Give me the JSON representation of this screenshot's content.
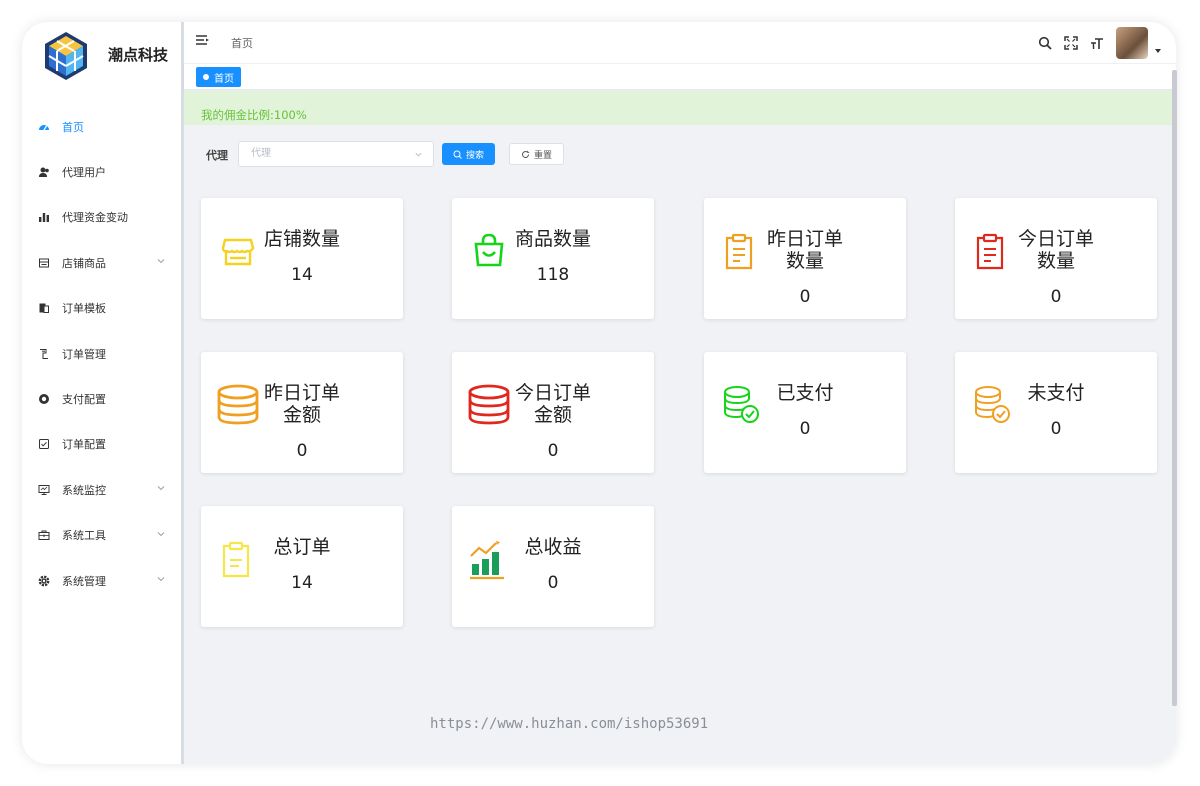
{
  "brand": {
    "name": "潮点科技"
  },
  "sidebar": {
    "items": [
      {
        "label": "首页",
        "icon": "dashboard-icon",
        "active": true,
        "expandable": false
      },
      {
        "label": "代理用户",
        "icon": "users-icon",
        "active": false,
        "expandable": false
      },
      {
        "label": "代理资金变动",
        "icon": "bar-chart-icon",
        "active": false,
        "expandable": false
      },
      {
        "label": "店铺商品",
        "icon": "shop-goods-icon",
        "active": false,
        "expandable": true
      },
      {
        "label": "订单模板",
        "icon": "template-icon",
        "active": false,
        "expandable": false
      },
      {
        "label": "订单管理",
        "icon": "order-manage-icon",
        "active": false,
        "expandable": false
      },
      {
        "label": "支付配置",
        "icon": "payment-config-icon",
        "active": false,
        "expandable": false
      },
      {
        "label": "订单配置",
        "icon": "order-config-icon",
        "active": false,
        "expandable": false
      },
      {
        "label": "系统监控",
        "icon": "monitor-icon",
        "active": false,
        "expandable": true
      },
      {
        "label": "系统工具",
        "icon": "toolbox-icon",
        "active": false,
        "expandable": true
      },
      {
        "label": "系统管理",
        "icon": "settings-gear-icon",
        "active": false,
        "expandable": true
      }
    ]
  },
  "navbar": {
    "breadcrumb": "首页"
  },
  "tags": {
    "active_tag": "首页"
  },
  "commission": {
    "text": "我的佣金比例:100%"
  },
  "filter": {
    "label": "代理",
    "select_placeholder": "代理",
    "search_label": "搜索",
    "reset_label": "重置"
  },
  "cards": [
    {
      "title": "店铺数量",
      "value": "14",
      "icon": "store-icon",
      "color": "#f5d21f"
    },
    {
      "title": "商品数量",
      "value": "118",
      "icon": "shopping-bag-icon",
      "color": "#16d418"
    },
    {
      "title": "昨日订单数量",
      "title_line1": "昨日订单",
      "title_line2": "数量",
      "value": "0",
      "icon": "clipboard-icon",
      "color": "#f0a020"
    },
    {
      "title": "今日订单数量",
      "title_line1": "今日订单",
      "title_line2": "数量",
      "value": "0",
      "icon": "clipboard-icon",
      "color": "#e0281c"
    },
    {
      "title": "昨日订单金额",
      "title_line1": "昨日订单",
      "title_line2": "金额",
      "value": "0",
      "icon": "coin-stack-icon",
      "color": "#f0a020"
    },
    {
      "title": "今日订单金额",
      "title_line1": "今日订单",
      "title_line2": "金额",
      "value": "0",
      "icon": "coin-stack-icon",
      "color": "#e0281c"
    },
    {
      "title": "已支付",
      "value": "0",
      "icon": "coins-check-icon",
      "color": "#16d418"
    },
    {
      "title": "未支付",
      "value": "0",
      "icon": "coins-check-icon",
      "color": "#f0a020"
    },
    {
      "title": "总订单",
      "value": "14",
      "icon": "clipboard-icon",
      "color": "#f5e64a"
    },
    {
      "title": "总收益",
      "value": "0",
      "icon": "growth-chart-icon",
      "color": "#1a9e5a"
    }
  ],
  "watermark": "https://www.huzhan.com/ishop53691",
  "colors": {
    "primary": "#1890ff",
    "success_bg": "#e1f3d8",
    "success_text": "#67c23a"
  }
}
